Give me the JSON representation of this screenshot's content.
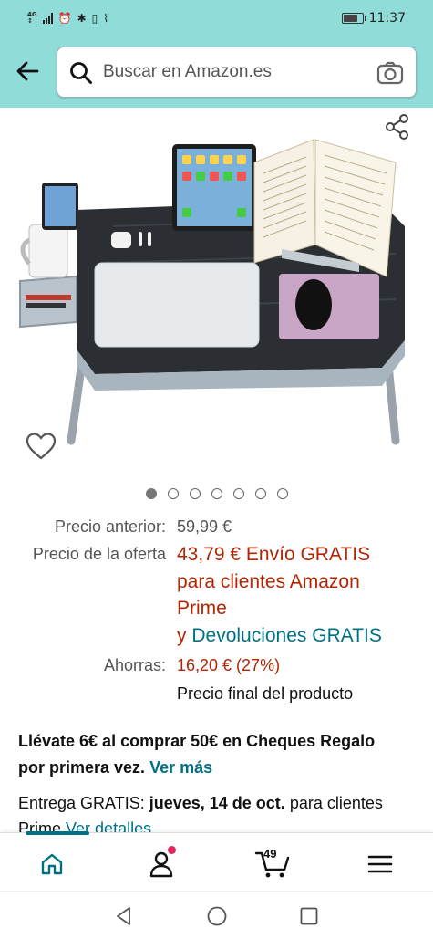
{
  "status_bar": {
    "network": "4G",
    "time": "11:37"
  },
  "search": {
    "placeholder": "Buscar en Amazon.es"
  },
  "gallery": {
    "image_count": 7,
    "active_index": 0
  },
  "price": {
    "previous_label": "Precio anterior:",
    "previous_value": "59,99 €",
    "deal_label": "Precio de la oferta",
    "deal_line1_price": "43,79 €",
    "deal_line1_rest": "Envío GRATIS",
    "deal_line2": "para clientes Amazon",
    "deal_line3": "Prime",
    "deal_line4_prefix": "y",
    "deal_line4_link": "Devoluciones GRATIS",
    "savings_label": "Ahorras:",
    "savings_value": "16,20 € (27%)",
    "final_note": "Precio final del producto"
  },
  "promo": {
    "line1": "Llévate 6€ al comprar 50€ en Cheques Regalo",
    "line2": "por primera vez.",
    "link": "Ver más"
  },
  "delivery": {
    "prefix": "Entrega GRATIS:",
    "date": "jueves, 14 de oct.",
    "suffix": "para clientes",
    "line2": "Prime",
    "link": "Ver detalles"
  },
  "bottom_nav": {
    "cart_count": "49"
  },
  "colors": {
    "header_bg": "#8fdcd9",
    "deal_red": "#b12704",
    "link_teal": "#007185"
  }
}
